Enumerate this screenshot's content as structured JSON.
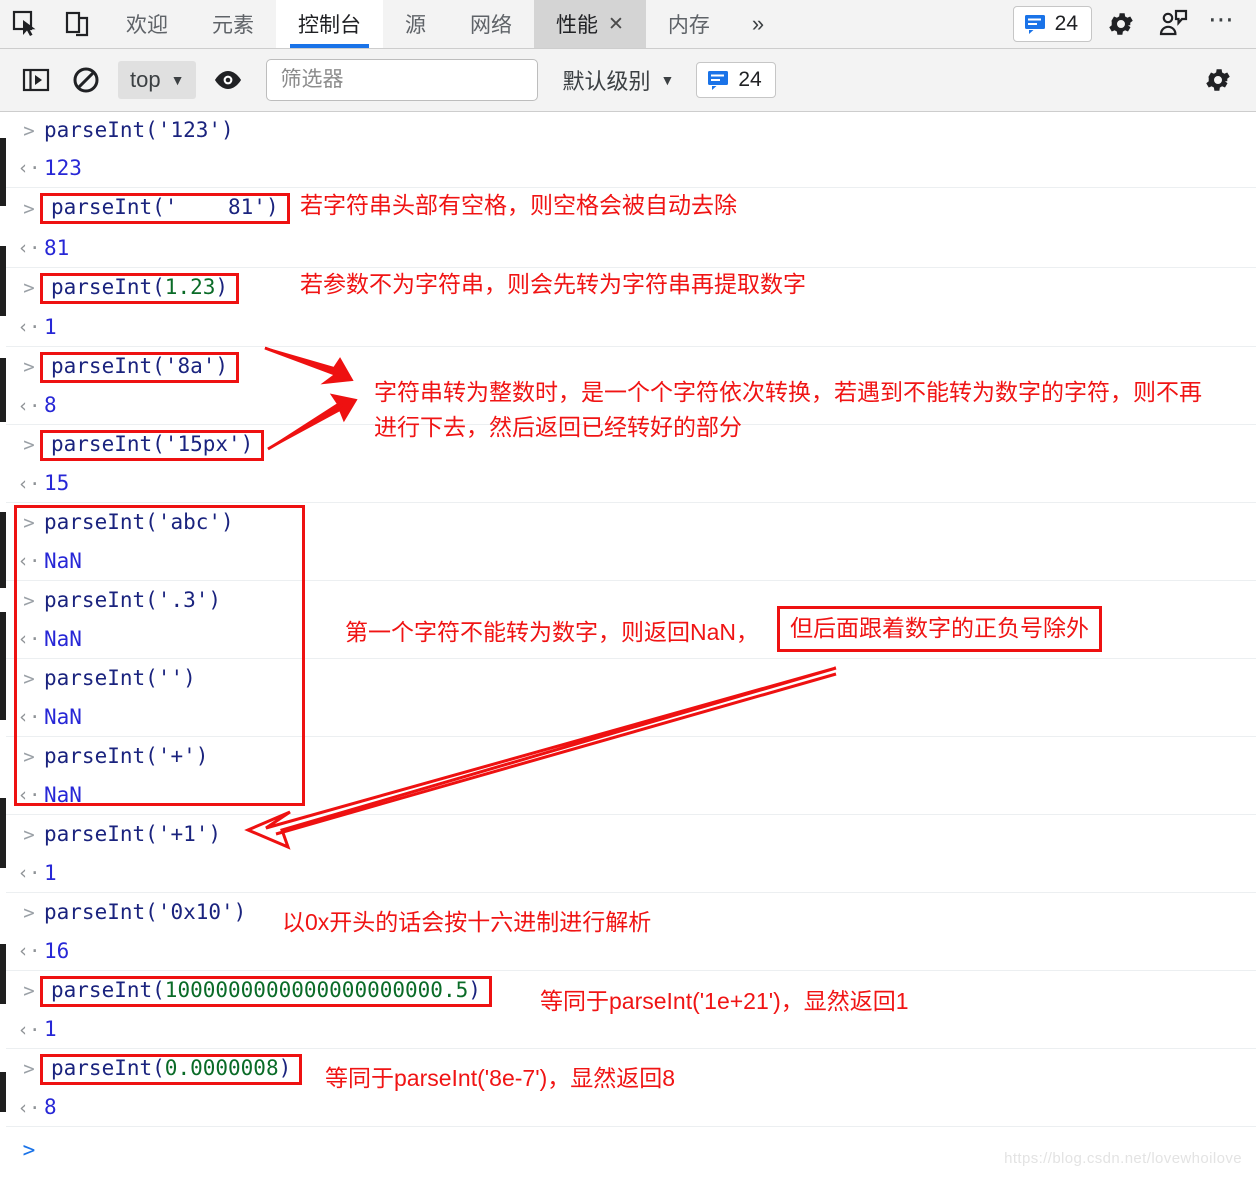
{
  "tabbar": {
    "inspect_icon": "inspect-cursor-icon",
    "device_icon": "device-toolbar-icon",
    "tabs": [
      {
        "label": "欢迎",
        "state": "normal"
      },
      {
        "label": "元素",
        "state": "normal"
      },
      {
        "label": "控制台",
        "state": "active"
      },
      {
        "label": "源",
        "state": "normal"
      },
      {
        "label": "网络",
        "state": "normal"
      },
      {
        "label": "性能",
        "state": "selected",
        "closable": true
      },
      {
        "label": "内存",
        "state": "normal"
      }
    ],
    "close_glyph": "✕",
    "more_tabs_glyph": "»",
    "message_count": "24",
    "message_icon": "message-badge-icon",
    "settings_icon": "gear-icon",
    "feedback_icon": "feedback-icon",
    "more_glyph": "⋯"
  },
  "filterbar": {
    "sidebar_icon": "show-console-sidebar-icon",
    "clear_icon": "clear-console-icon",
    "context": {
      "label": "top",
      "caret": "▼"
    },
    "eye_icon": "live-expression-eye-icon",
    "filter_placeholder": "筛选器",
    "filter_value": "",
    "level": {
      "label": "默认级别",
      "caret": "▼"
    },
    "message_count": "24",
    "message_icon": "message-badge-icon",
    "settings_icon": "gear-icon"
  },
  "console": {
    "input_glyph": ">",
    "output_glyph": "‹·",
    "prompt_glyph": ">",
    "entries": [
      {
        "id": "e1",
        "code_pre": "parseInt(",
        "code_arg": "'123'",
        "arg_kind": "string",
        "code_post": ")",
        "result": "123",
        "boxed": false
      },
      {
        "id": "e2",
        "code_pre": "parseInt(",
        "code_arg": "'    81'",
        "arg_kind": "string",
        "code_post": ")",
        "result": "81",
        "boxed": true
      },
      {
        "id": "e3",
        "code_pre": "parseInt(",
        "code_arg": "1.23",
        "arg_kind": "number",
        "code_post": ")",
        "result": "1",
        "boxed": true
      },
      {
        "id": "e4",
        "code_pre": "parseInt(",
        "code_arg": "'8a'",
        "arg_kind": "string",
        "code_post": ")",
        "result": "8",
        "boxed": true
      },
      {
        "id": "e5",
        "code_pre": "parseInt(",
        "code_arg": "'15px'",
        "arg_kind": "string",
        "code_post": ")",
        "result": "15",
        "boxed": true
      },
      {
        "id": "e6",
        "code_pre": "parseInt(",
        "code_arg": "'abc'",
        "arg_kind": "string",
        "code_post": ")",
        "result": "NaN",
        "boxed": false
      },
      {
        "id": "e7",
        "code_pre": "parseInt(",
        "code_arg": "'.3'",
        "arg_kind": "string",
        "code_post": ")",
        "result": "NaN",
        "boxed": false
      },
      {
        "id": "e8",
        "code_pre": "parseInt(",
        "code_arg": "''",
        "arg_kind": "string",
        "code_post": ")",
        "result": "NaN",
        "boxed": false
      },
      {
        "id": "e9",
        "code_pre": "parseInt(",
        "code_arg": "'+'",
        "arg_kind": "string",
        "code_post": ")",
        "result": "NaN",
        "boxed": false
      },
      {
        "id": "e10",
        "code_pre": "parseInt(",
        "code_arg": "'+1'",
        "arg_kind": "string",
        "code_post": ")",
        "result": "1",
        "boxed": false
      },
      {
        "id": "e11",
        "code_pre": "parseInt(",
        "code_arg": "'0x10'",
        "arg_kind": "string",
        "code_post": ")",
        "result": "16",
        "boxed": false
      },
      {
        "id": "e12",
        "code_pre": "parseInt(",
        "code_arg": "1000000000000000000000.5",
        "arg_kind": "number",
        "code_post": ")",
        "result": "1",
        "boxed": true
      },
      {
        "id": "e13",
        "code_pre": "parseInt(",
        "code_arg": "0.0000008",
        "arg_kind": "number",
        "code_post": ")",
        "result": "8",
        "boxed": true
      }
    ]
  },
  "annotations": {
    "a1": "若字符串头部有空格，则空格会被自动去除",
    "a2": "若参数不为字符串，则会先转为字符串再提取数字",
    "a3_line1": "字符串转为整数时，是一个个字符依次转换，若遇到不能转为数字的字符，则不再",
    "a3_line2": "进行下去，然后返回已经转好的部分",
    "a4": "第一个字符不能转为数字，则返回NaN，",
    "a4_boxed": "但后面跟着数字的正负号除外",
    "a5": "以0x开头的话会按十六进制进行解析",
    "a6": "等同于parseInt('1e+21')，显然返回1",
    "a7": "等同于parseInt('8e-7')，显然返回8"
  },
  "watermark": "https://blog.csdn.net/lovewhoilove",
  "colors": {
    "accent": "#1a73e8",
    "annotation_red": "#f01414",
    "box_red": "#ee1111",
    "code_navy": "#1a237e",
    "code_number_green": "#0a6b27",
    "result_blue": "#2727d6"
  }
}
